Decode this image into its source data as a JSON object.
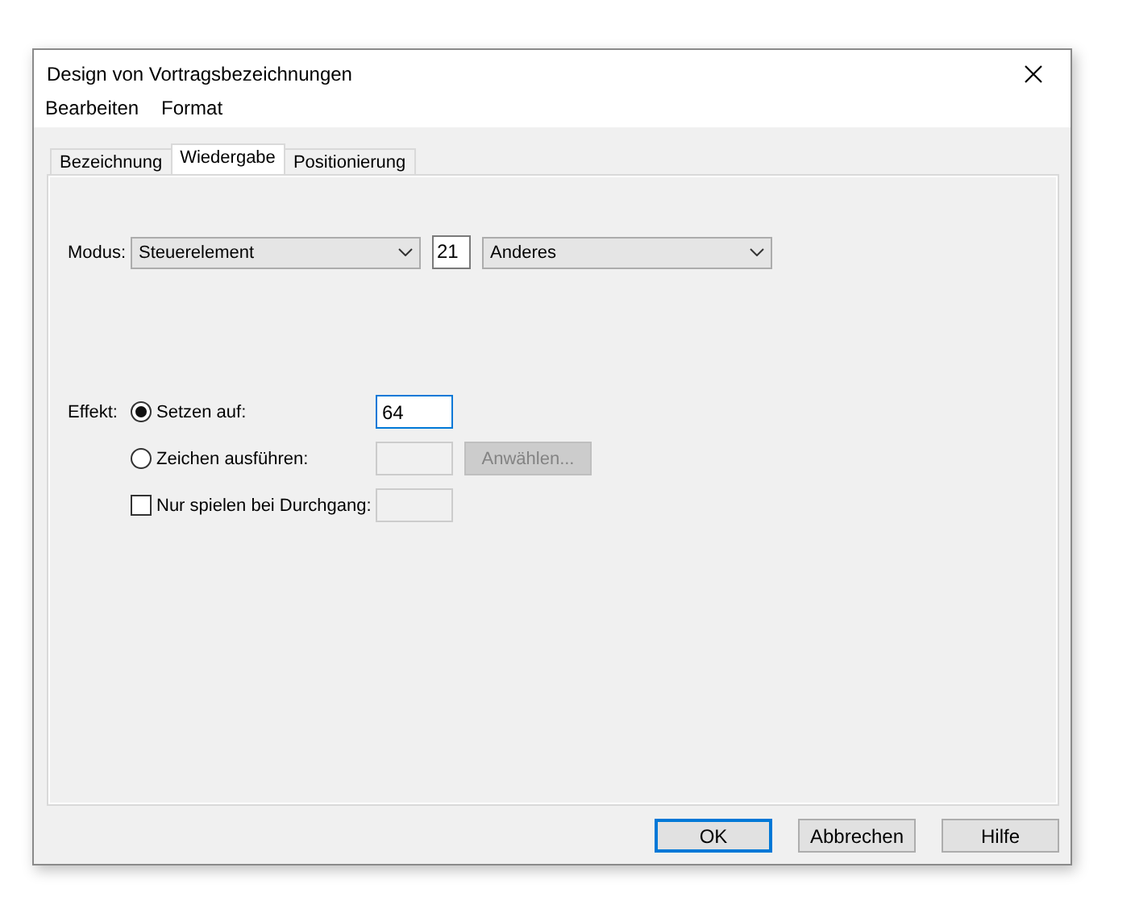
{
  "window": {
    "title": "Design von Vortragsbezeichnungen"
  },
  "menu": [
    "Bearbeiten",
    "Format"
  ],
  "tabs": [
    {
      "label": "Bezeichnung",
      "selected": false
    },
    {
      "label": "Wiedergabe",
      "selected": true
    },
    {
      "label": "Positionierung",
      "selected": false
    }
  ],
  "mode": {
    "label": "Modus:",
    "type_select": "Steuerelement",
    "number": "21",
    "kind_select": "Anderes"
  },
  "effect": {
    "label": "Effekt:",
    "options": [
      {
        "kind": "radio",
        "label": "Setzen auf:",
        "selected": true,
        "field": {
          "value": "64",
          "disabled": false,
          "focused": true
        }
      },
      {
        "kind": "radio",
        "label": "Zeichen ausführen:",
        "selected": false,
        "field": {
          "disabled": true,
          "focused": false
        },
        "button": {
          "label": "Anwählen...",
          "disabled": true
        }
      },
      {
        "kind": "checkbox",
        "label": "Nur spielen bei Durchgang:",
        "checked": false,
        "field": {
          "disabled": true,
          "focused": false
        }
      }
    ]
  },
  "buttons": [
    {
      "label": "OK",
      "default": true
    },
    {
      "label": "Abbrechen",
      "default": false
    },
    {
      "label": "Hilfe",
      "default": false
    }
  ]
}
